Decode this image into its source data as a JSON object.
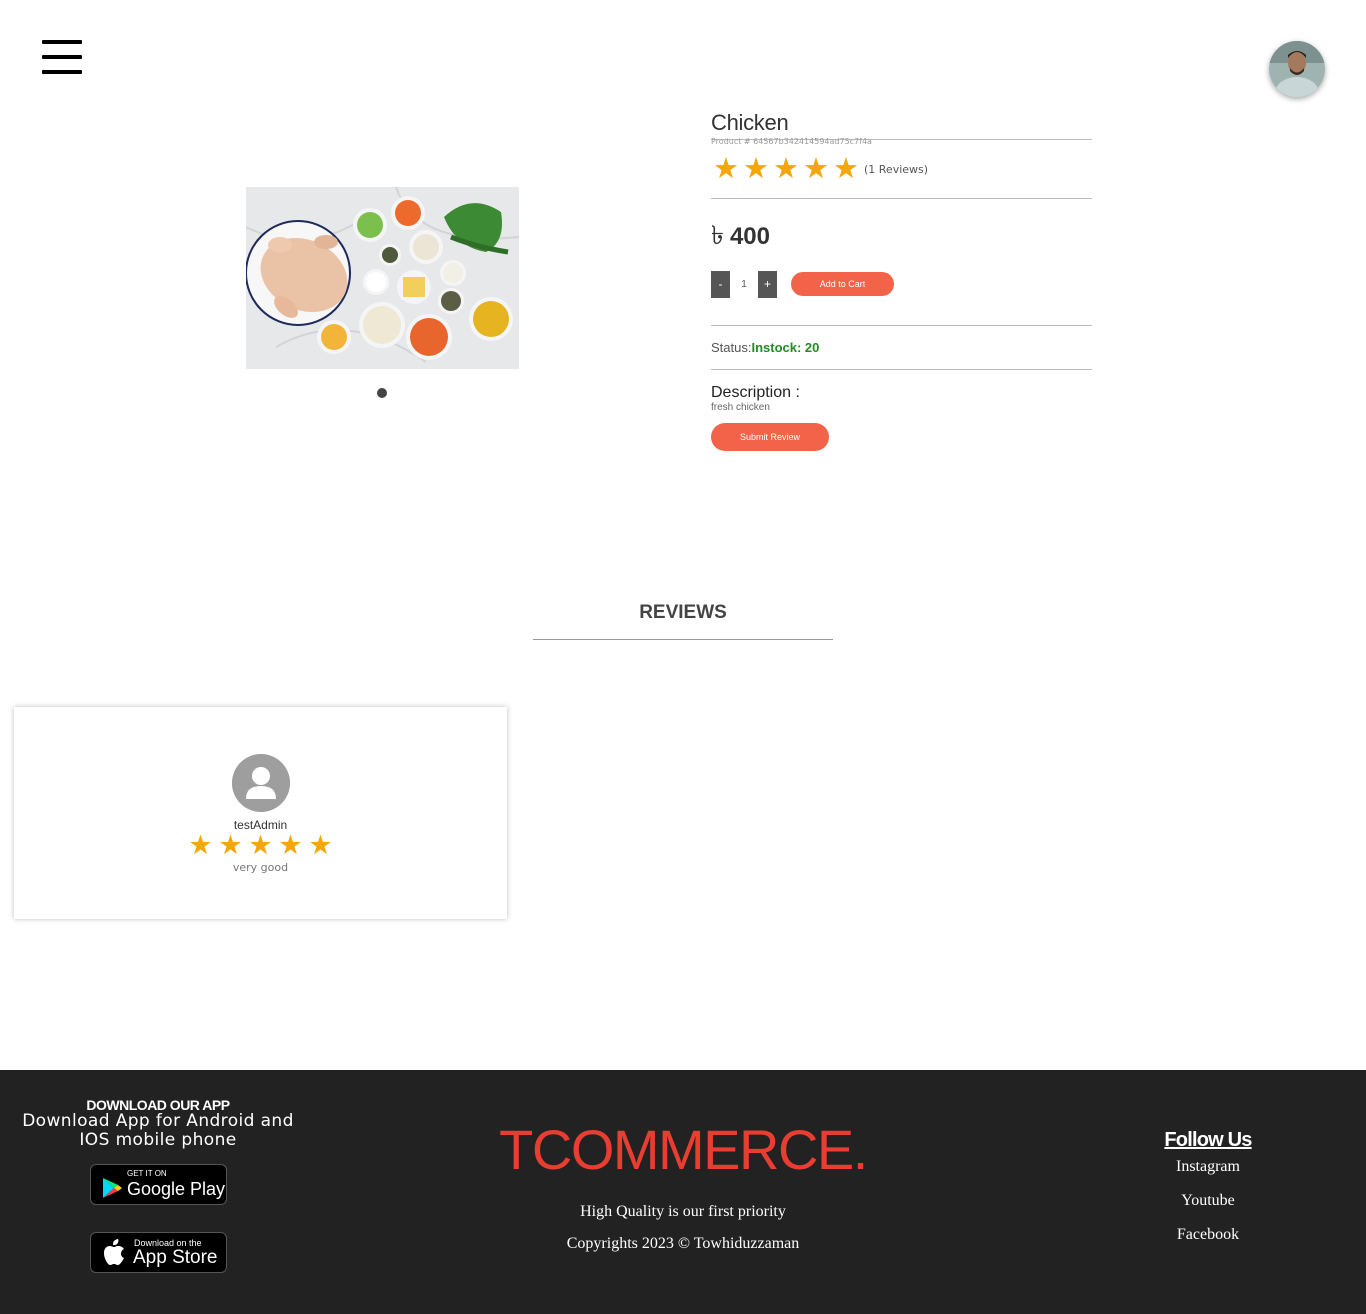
{
  "header": {
    "menu_icon": "hamburger-menu-icon",
    "avatar_icon": "user-profile-photo"
  },
  "product": {
    "title": "Chicken",
    "product_id": "Product # 64567b342414594ad75c7f4a",
    "rating": 5,
    "stars": [
      "★",
      "★",
      "★",
      "★",
      "★"
    ],
    "reviews_count": "(1 Reviews)",
    "currency_symbol": "৳",
    "price": "400",
    "qty_minus": "-",
    "quantity": "1",
    "qty_plus": "+",
    "add_to_cart": "Add to Cart",
    "status_label": "Status:",
    "status_value": "Instock: 20",
    "description_title": "Description :",
    "description_text": "fresh chicken",
    "submit_review": "Submit Review",
    "image_icon": "raw-chicken-with-vegetables-image",
    "colors": {
      "accent": "#f26349",
      "star": "#f5a60b",
      "in_stock": "#228b22"
    }
  },
  "reviews": {
    "heading": "REVIEWS",
    "items": [
      {
        "name": "testAdmin",
        "rating": 5,
        "stars": [
          "★",
          "★",
          "★",
          "★",
          "★"
        ],
        "comment": "very good",
        "avatar_icon": "default-user-avatar-icon"
      }
    ]
  },
  "footer": {
    "download_heading": "DOWNLOAD OUR APP",
    "download_text": "Download App for Android and IOS mobile phone",
    "google_play_small": "GET IT ON",
    "google_play_big": "Google Play",
    "app_store_small": "Download on the",
    "app_store_big": "App Store",
    "brand": "TCOMMERCE.",
    "tagline": "High Quality is our first priority",
    "copyright": "Copyrights 2023 © Towhiduzzaman",
    "follow_heading": "Follow Us",
    "social": [
      "Instagram",
      "Youtube",
      "Facebook"
    ],
    "colors": {
      "background": "#222222",
      "brand": "#e83e32"
    }
  }
}
